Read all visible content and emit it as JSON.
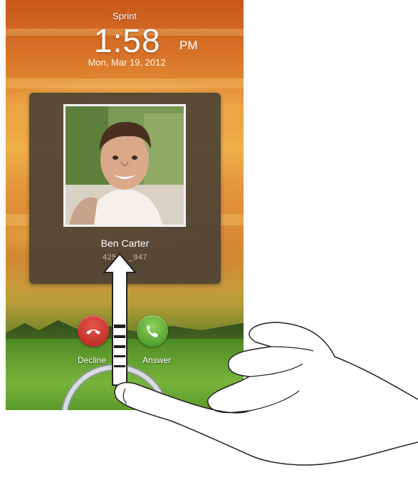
{
  "status": {
    "carrier": "Sprint"
  },
  "lockscreen": {
    "time": "1:58",
    "ampm": "PM",
    "date": "Mon, Mar 19, 2012"
  },
  "incoming_call": {
    "caller_name": "Ben Carter",
    "caller_number": "4256_ _947"
  },
  "actions": {
    "decline_label": "Decline",
    "answer_label": "Answer"
  },
  "colors": {
    "decline": "#c8342a",
    "answer": "#5fae34",
    "card_bg": "#463e34"
  },
  "icons": {
    "decline": "phone-hangup-icon",
    "answer": "phone-answer-icon"
  },
  "gesture": {
    "direction": "up",
    "hint": "drag-ring-to-unlock"
  }
}
